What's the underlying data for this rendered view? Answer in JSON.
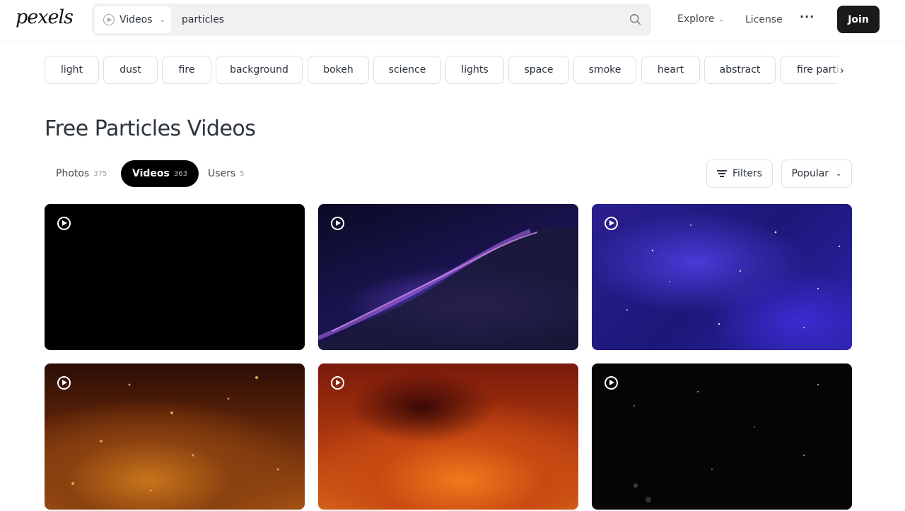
{
  "header": {
    "logo": "pexels",
    "search": {
      "type_label": "Videos",
      "query": "particles"
    },
    "nav": {
      "explore": "Explore",
      "license": "License",
      "more": "···",
      "join": "Join"
    }
  },
  "tags": [
    "light",
    "dust",
    "fire",
    "background",
    "bokeh",
    "science",
    "lights",
    "space",
    "smoke",
    "heart",
    "abstract",
    "fire particles"
  ],
  "title": "Free Particles Videos",
  "tabs": [
    {
      "label": "Photos",
      "count": "375",
      "active": false
    },
    {
      "label": "Videos",
      "count": "363",
      "active": true
    },
    {
      "label": "Users",
      "count": "5",
      "active": false
    }
  ],
  "controls": {
    "filters": "Filters",
    "sort": "Popular"
  },
  "icons": {
    "search": "search-icon",
    "play": "play-circle-icon",
    "filter": "filter-icon",
    "chevron": "chevron-down-icon",
    "arrow": "chevron-right-icon"
  }
}
